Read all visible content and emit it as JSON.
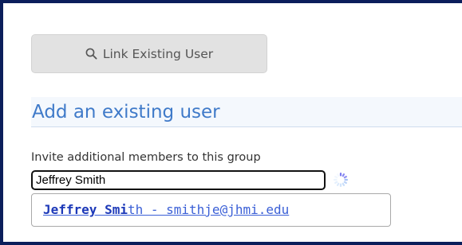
{
  "toolbar": {
    "link_existing_user_label": "Link Existing User",
    "link_icon": "search-icon"
  },
  "section": {
    "heading": "Add an existing user"
  },
  "invite": {
    "label": "Invite additional members to this group",
    "input_value": "Jeffrey Smith",
    "loading_icon": "spinner-icon"
  },
  "autocomplete": {
    "match_text": "Jeffrey Smi",
    "rest_text": "th - smithje@jhmi.edu"
  },
  "colors": {
    "frame_border": "#0b1e5b",
    "heading_text": "#3f7ac9",
    "suggestion_link": "#3a5fd6"
  }
}
